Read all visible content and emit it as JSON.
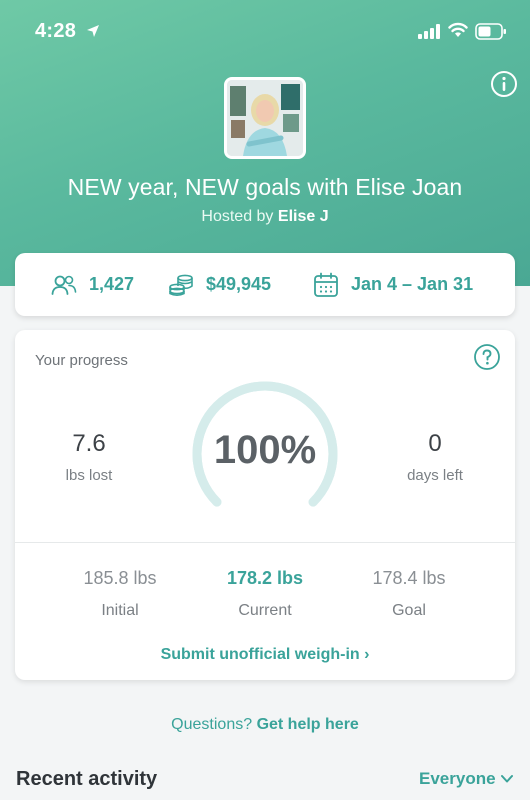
{
  "status_bar": {
    "time": "4:28"
  },
  "challenge": {
    "title": "NEW year, NEW goals with Elise Joan",
    "hosted_prefix": "Hosted by",
    "host_name": "Elise J"
  },
  "stats": {
    "participants": "1,427",
    "pot": "$49,945",
    "dates": "Jan 4 – Jan 31"
  },
  "progress": {
    "label": "Your progress",
    "percent": "100%",
    "percent_value": 100,
    "lost_value": "7.6",
    "lost_label": "lbs lost",
    "days_value": "0",
    "days_label": "days left",
    "initial_value": "185.8",
    "initial_label": "Initial",
    "current_value": "178.2",
    "current_label": "Current",
    "goal_value": "178.4",
    "goal_label": "Goal",
    "unit": "lbs",
    "submit_label": "Submit unofficial weigh-in ›"
  },
  "help": {
    "prefix": "Questions?",
    "link": "Get help here"
  },
  "activity": {
    "title": "Recent activity",
    "filter": "Everyone"
  },
  "colors": {
    "accent": "#3aa39a",
    "hero": "#5ab99e",
    "gauge_track": "#d5eceb"
  }
}
